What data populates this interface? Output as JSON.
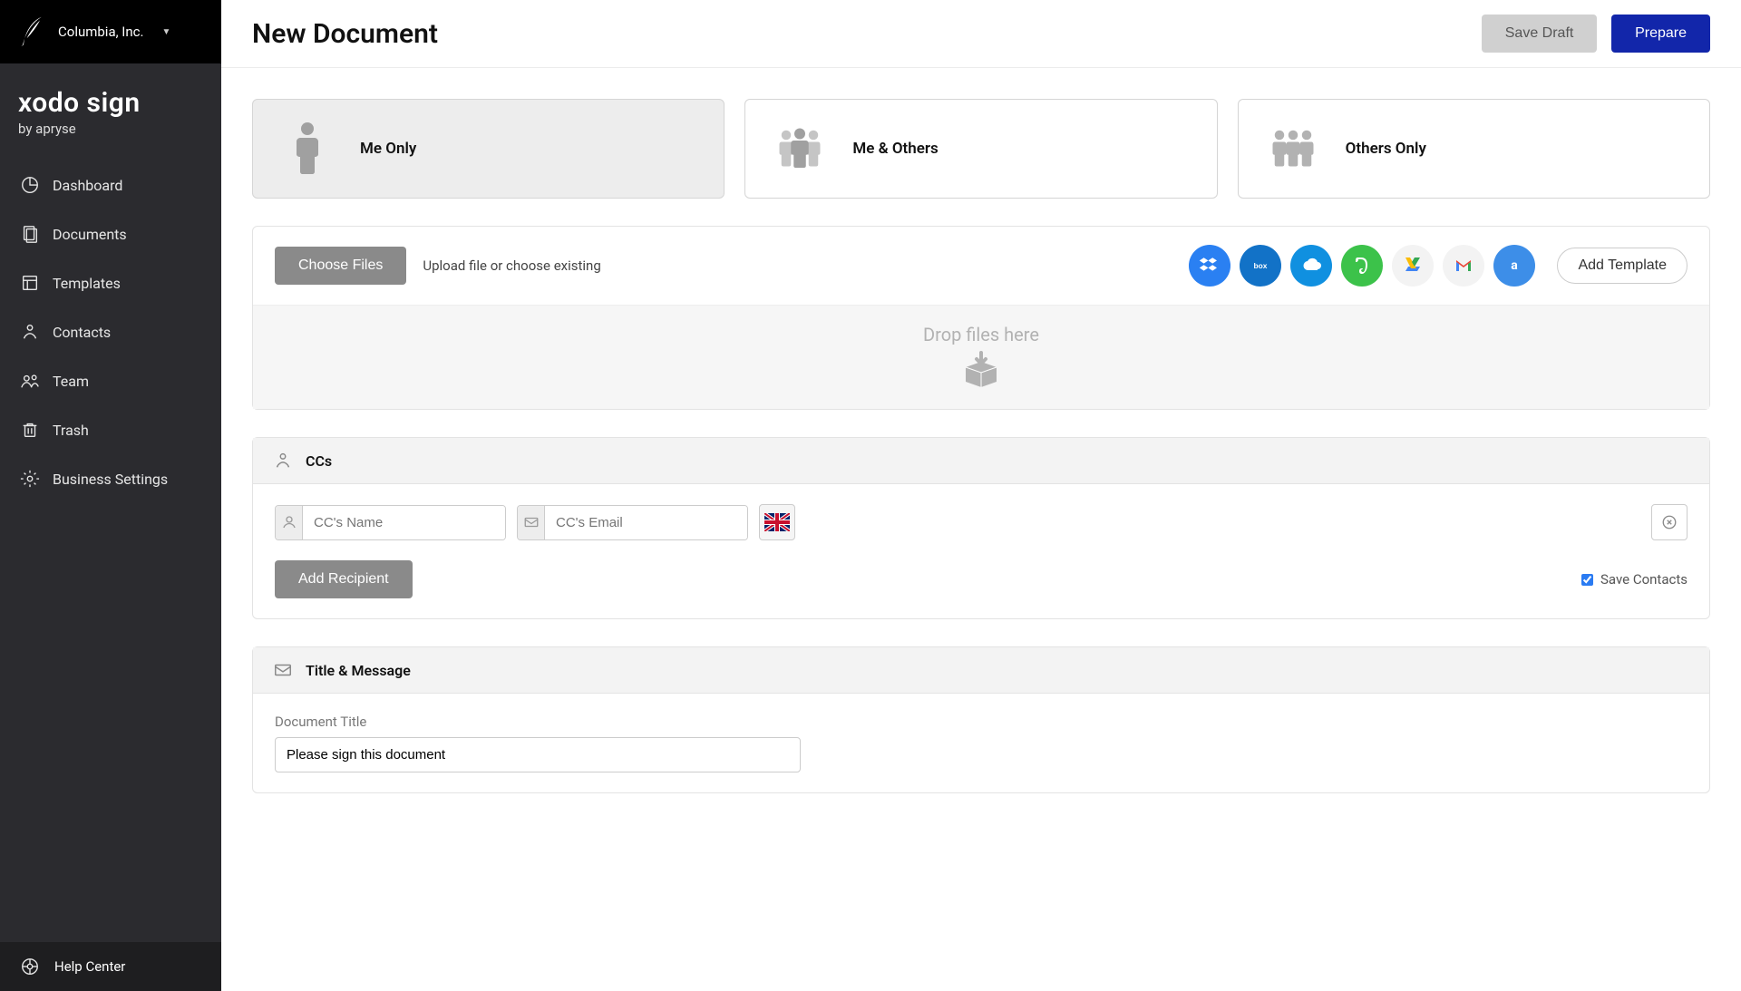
{
  "header": {
    "account": "Columbia, Inc.",
    "brand_title": "xodo sign",
    "brand_sub": "by apryse"
  },
  "sidebar": {
    "items": [
      {
        "label": "Dashboard"
      },
      {
        "label": "Documents"
      },
      {
        "label": "Templates"
      },
      {
        "label": "Contacts"
      },
      {
        "label": "Team"
      },
      {
        "label": "Trash"
      },
      {
        "label": "Business Settings"
      }
    ],
    "help": "Help Center"
  },
  "topbar": {
    "title": "New Document",
    "save_draft": "Save Draft",
    "prepare": "Prepare"
  },
  "cards": [
    {
      "label": "Me Only",
      "selected": true
    },
    {
      "label": "Me & Others",
      "selected": false
    },
    {
      "label": "Others Only",
      "selected": false
    }
  ],
  "files": {
    "choose": "Choose Files",
    "hint": "Upload file or choose existing",
    "add_template": "Add Template",
    "dropzone": "Drop files here",
    "providers": [
      "dropbox",
      "box",
      "onedrive",
      "evernote",
      "drive",
      "gmail",
      "amazon"
    ]
  },
  "ccs": {
    "title": "CCs",
    "name_placeholder": "CC's Name",
    "email_placeholder": "CC's Email",
    "add_recipient": "Add Recipient",
    "save_contacts": "Save Contacts",
    "flag": "uk"
  },
  "title_section": {
    "heading": "Title & Message",
    "doc_title_label": "Document Title",
    "doc_title_value": "Please sign this document"
  }
}
